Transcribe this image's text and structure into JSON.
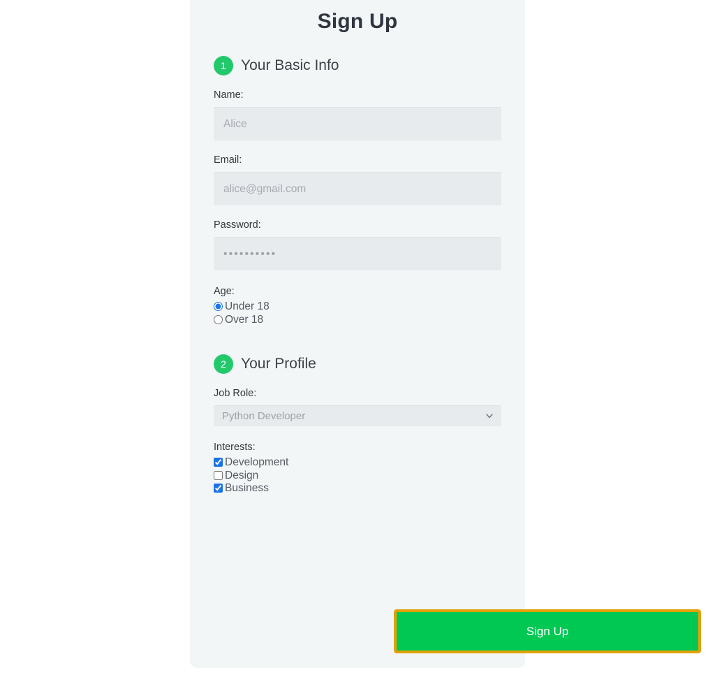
{
  "form": {
    "title": "Sign Up",
    "sections": [
      {
        "step": "1",
        "heading": "Your Basic Info"
      },
      {
        "step": "2",
        "heading": "Your Profile"
      }
    ],
    "fields": {
      "name": {
        "label": "Name:",
        "placeholder": "Alice",
        "value": ""
      },
      "email": {
        "label": "Email:",
        "placeholder": "alice@gmail.com",
        "value": ""
      },
      "password": {
        "label": "Password:",
        "masked_value": "••••••••••",
        "value": ""
      },
      "age": {
        "label": "Age:",
        "options": [
          {
            "label": "Under 18",
            "checked": true
          },
          {
            "label": "Over 18",
            "checked": false
          }
        ]
      },
      "job_role": {
        "label": "Job Role:",
        "selected": "Python Developer",
        "options": [
          "Python Developer"
        ]
      },
      "interests": {
        "label": "Interests:",
        "options": [
          {
            "label": "Development",
            "checked": true
          },
          {
            "label": "Design",
            "checked": false
          },
          {
            "label": "Business",
            "checked": true
          }
        ]
      }
    },
    "submit_label": "Sign Up"
  },
  "colors": {
    "page_background": "#ffffff",
    "card_background": "#f2f6f7",
    "step_badge": "#22c96b",
    "submit_background": "#00c853",
    "submit_focus_outline": "#e3a008",
    "input_background": "#e8ebee",
    "control_accent": "#1a73e8",
    "title_text": "#2f3640"
  }
}
